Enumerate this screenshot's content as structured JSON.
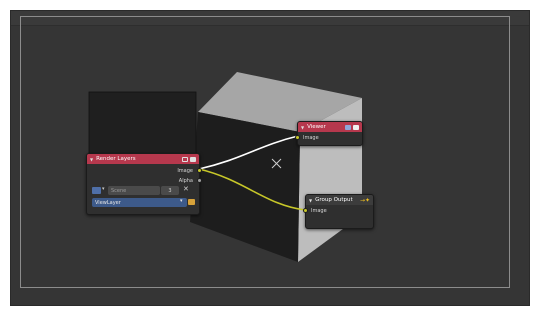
{
  "editor": {
    "background_color": "#353535",
    "cursor_icon": "cross-cursor-icon"
  },
  "nodes": {
    "render_layers": {
      "title": "Render Layers",
      "header_color": "#b6384d",
      "outputs": [
        "Image",
        "Alpha"
      ],
      "scene_field": "Scene",
      "scene_count": "3",
      "view_layer": "ViewLayer"
    },
    "viewer": {
      "title": "Viewer",
      "header_color": "#b6384d",
      "input": "Image"
    },
    "group_output": {
      "title": "Group Output",
      "input": "Image"
    }
  },
  "links": {
    "to_viewer_color": "#ffffff",
    "to_group_output_color": "#c7c729"
  }
}
